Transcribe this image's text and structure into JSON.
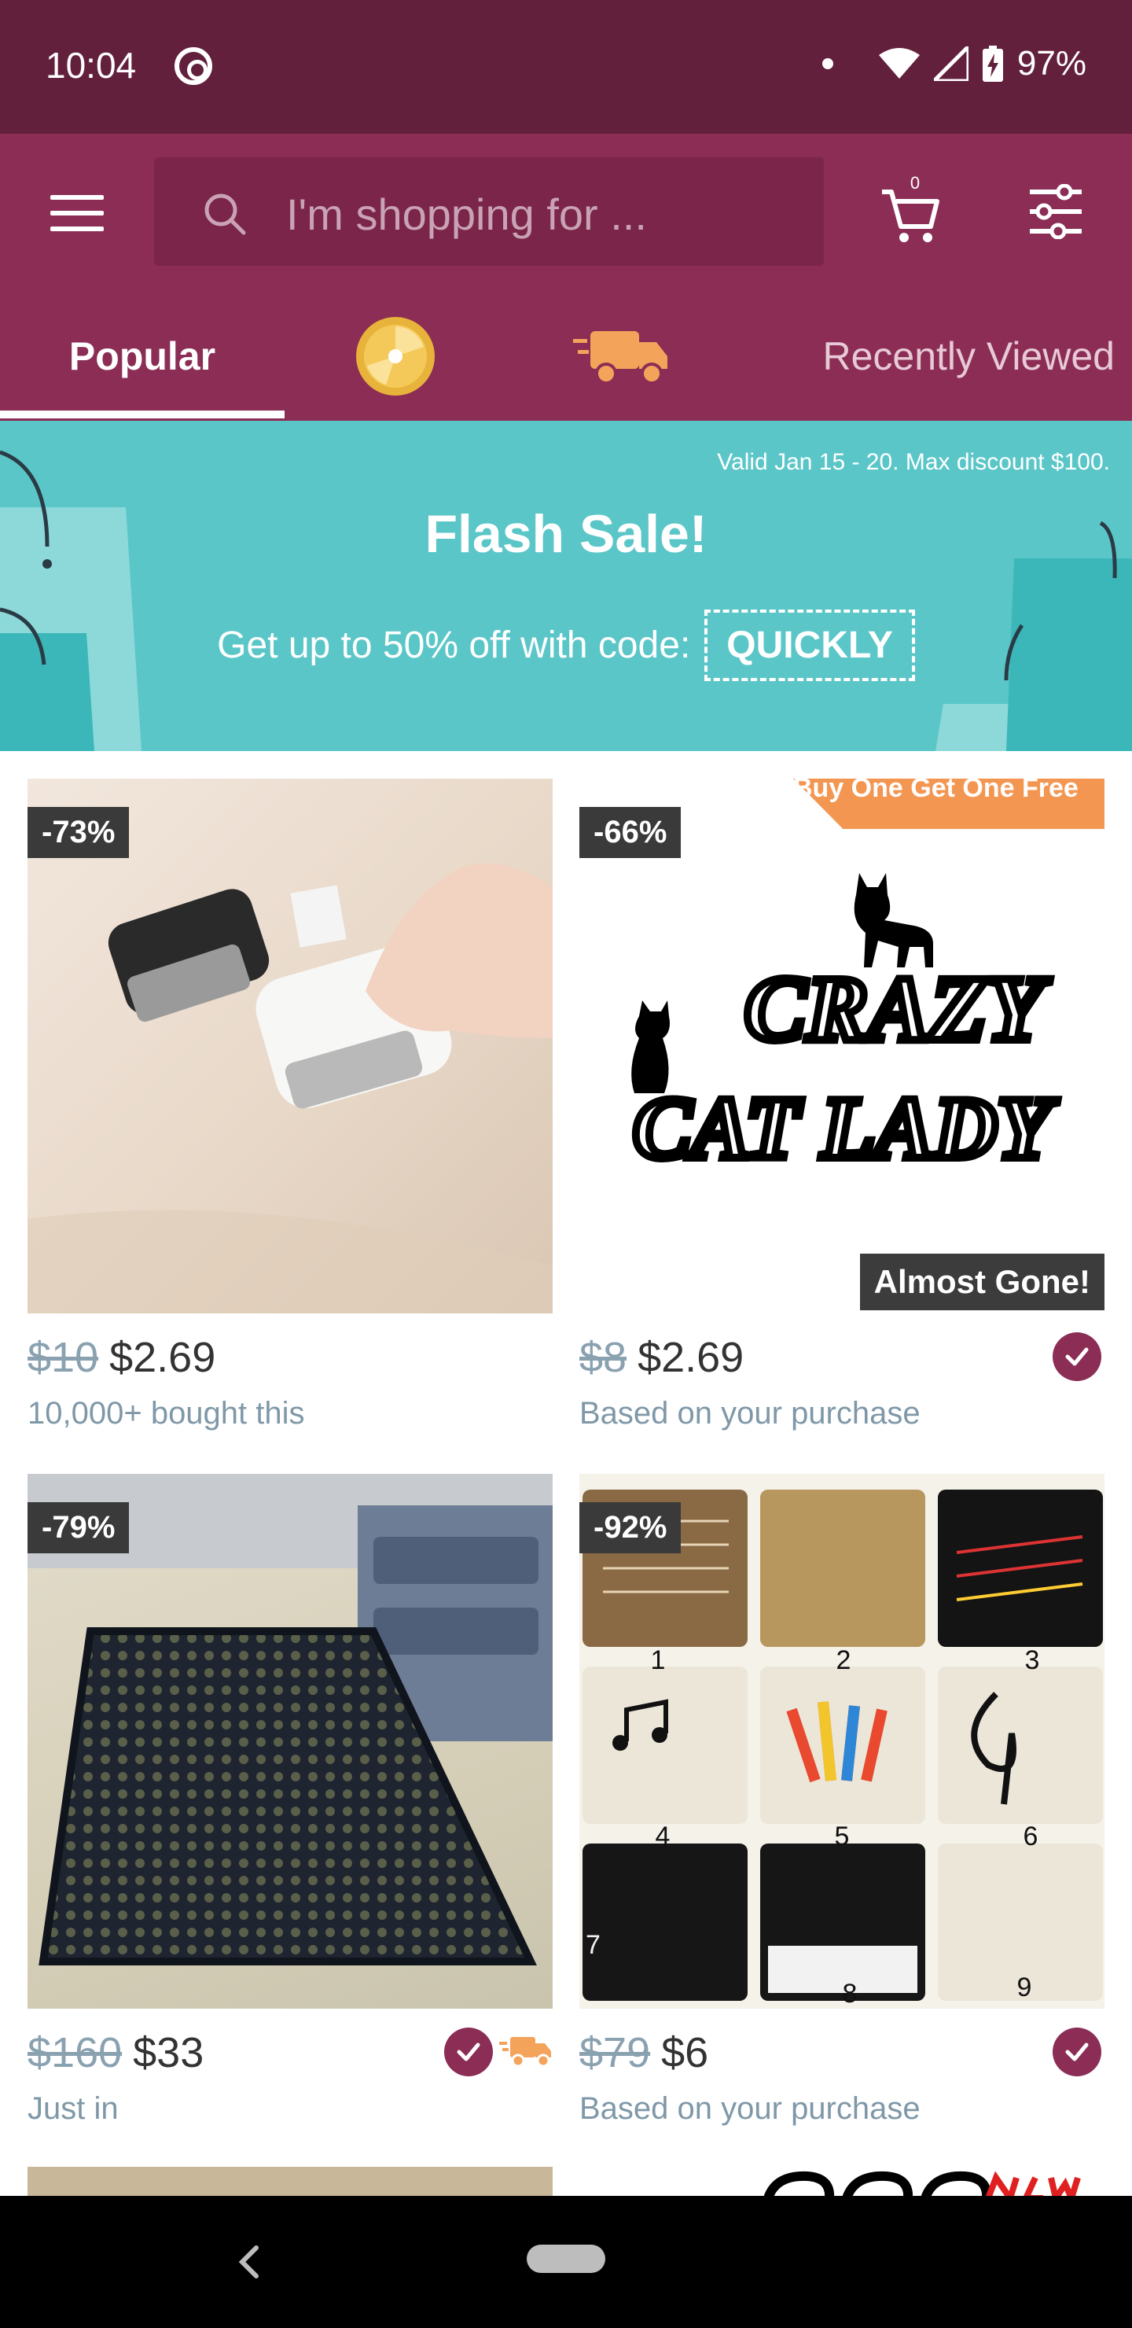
{
  "status_bar": {
    "time": "10:04",
    "battery": "97%"
  },
  "header": {
    "search_placeholder": "I'm shopping for ..."
  },
  "tabs": [
    {
      "label": "Popular",
      "active": true
    },
    {
      "icon": "coin-wheel-icon"
    },
    {
      "icon": "fast-delivery-truck-icon"
    },
    {
      "label": "Recently Viewed"
    }
  ],
  "banner": {
    "valid_text": "Valid Jan 15 - 20. Max discount $100.",
    "title": "Flash Sale!",
    "subtitle": "Get up to 50% off with code:",
    "code": "QUICKLY"
  },
  "products": [
    {
      "discount": "-73%",
      "original_price": "$10",
      "price": "$2.69",
      "note": "10,000+ bought this"
    },
    {
      "discount": "-66%",
      "promo": "Buy One Get One Free !",
      "badge": "Almost Gone!",
      "image_text_top": "CRAZY",
      "image_text_bottom": "CAT LADY",
      "original_price": "$8",
      "price": "$2.69",
      "note": "Based on your purchase",
      "verified": true
    },
    {
      "discount": "-79%",
      "original_price": "$160",
      "price": "$33",
      "note": "Just in",
      "verified": true,
      "fast_shipping": true
    },
    {
      "discount": "-92%",
      "image_numbers": [
        "1",
        "2",
        "3",
        "4",
        "5",
        "6",
        "7",
        "8",
        "9"
      ],
      "original_price": "$79",
      "price": "$6",
      "note": "Based on your purchase",
      "verified": true
    }
  ],
  "colors": {
    "brand": "#8b2d55",
    "status_bar": "#62203d",
    "banner": "#5bc6c8",
    "accent_orange": "#f39652"
  }
}
